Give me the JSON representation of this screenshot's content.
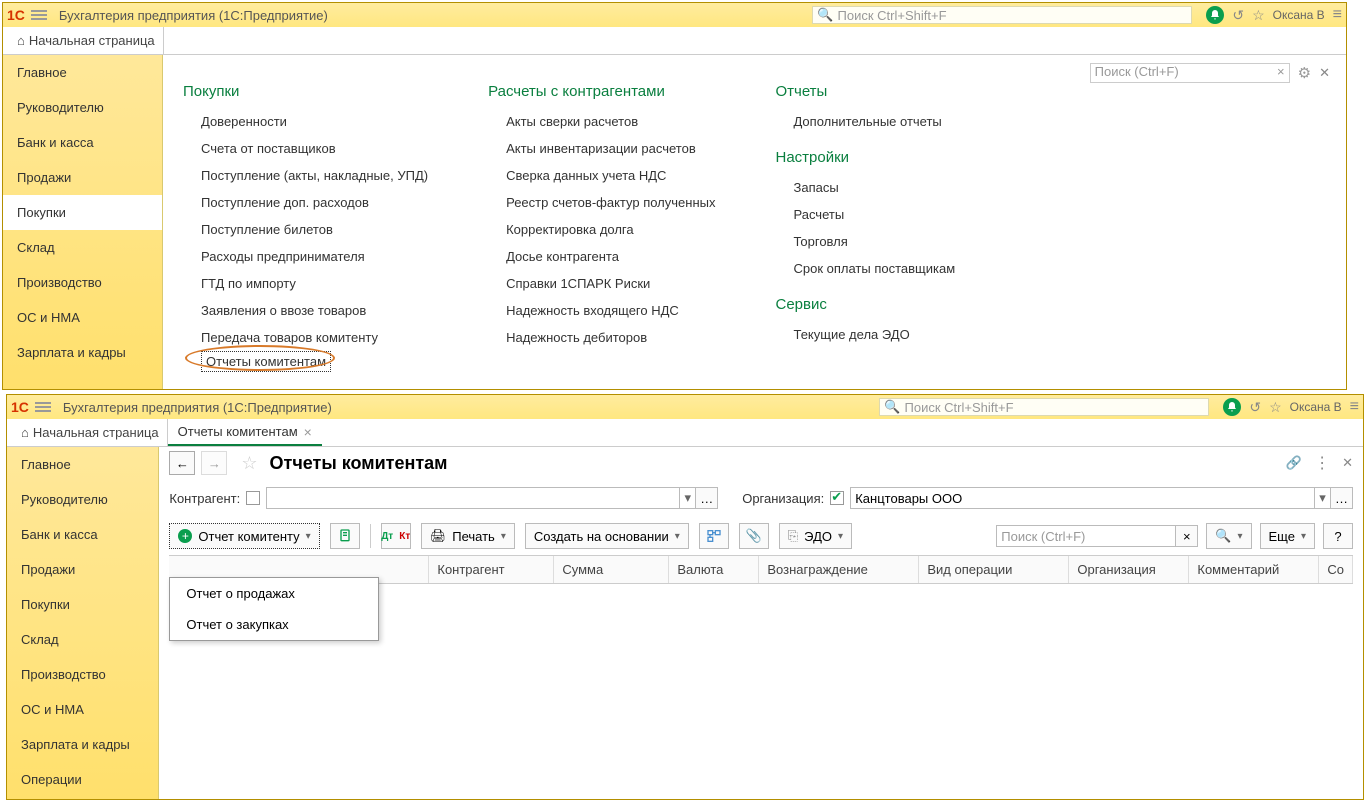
{
  "app_title": "Бухгалтерия предприятия  (1С:Предприятие)",
  "search_placeholder": "Поиск Ctrl+Shift+F",
  "user": "Оксана В",
  "home_tab": "Начальная страница",
  "sidebar": [
    "Главное",
    "Руководителю",
    "Банк и касса",
    "Продажи",
    "Покупки",
    "Склад",
    "Производство",
    "ОС и НМА",
    "Зарплата и кадры"
  ],
  "sidebar2_extra": "Операции",
  "page_search_placeholder": "Поиск (Ctrl+F)",
  "sections": {
    "purchases": {
      "title": "Покупки",
      "items": [
        "Доверенности",
        "Счета от поставщиков",
        "Поступление (акты, накладные, УПД)",
        "Поступление доп. расходов",
        "Поступление билетов",
        "Расходы предпринимателя",
        "ГТД по импорту",
        "Заявления о ввозе товаров",
        "Передача товаров комитенту",
        "Отчеты комитентам"
      ]
    },
    "settlements": {
      "title": "Расчеты с контрагентами",
      "items": [
        "Акты сверки расчетов",
        "Акты инвентаризации расчетов",
        "Сверка данных учета НДС",
        "Реестр счетов-фактур полученных",
        "Корректировка долга",
        "Досье контрагента",
        "Справки 1СПАРК Риски",
        "Надежность входящего НДС",
        "Надежность дебиторов"
      ]
    },
    "reports": {
      "title": "Отчеты",
      "items": [
        "Дополнительные отчеты"
      ]
    },
    "settings": {
      "title": "Настройки",
      "items": [
        "Запасы",
        "Расчеты",
        "Торговля",
        "Срок оплаты поставщикам"
      ]
    },
    "service": {
      "title": "Сервис",
      "items": [
        "Текущие дела ЭДО"
      ]
    }
  },
  "win2": {
    "tab_label": "Отчеты комитентам",
    "page_title": "Отчеты комитентам",
    "filter_contr": "Контрагент:",
    "filter_org": "Организация:",
    "org_value": "Канцтовары ООО",
    "btn_create": "Отчет комитенту",
    "menu_items": [
      "Отчет о продажах",
      "Отчет о закупках"
    ],
    "btn_print": "Печать",
    "btn_create_basis": "Создать на основании",
    "btn_edo": "ЭДО",
    "btn_more": "Еще",
    "search_hint": "Поиск (Ctrl+F)",
    "help_q": "?",
    "grid_cols": [
      "Контрагент",
      "Сумма",
      "Валюта",
      "Вознаграждение",
      "Вид операции",
      "Организация",
      "Комментарий",
      "Со"
    ]
  }
}
